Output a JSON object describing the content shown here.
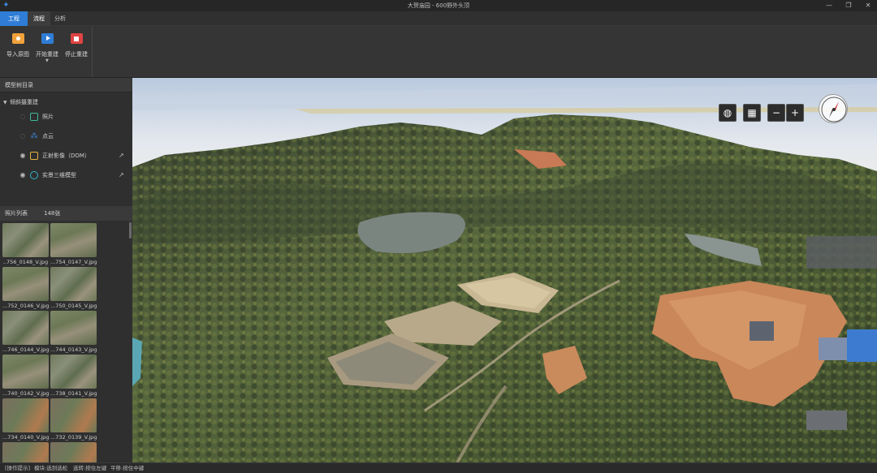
{
  "window": {
    "title": "大贺庙园 - 600野外头顶"
  },
  "menu": {
    "tabs": [
      "工程",
      "流程",
      "分析"
    ]
  },
  "ribbon": {
    "buttons": [
      {
        "label": "导入原图",
        "icon": "folder-camera-icon"
      },
      {
        "label": "开始重建",
        "icon": "play-icon"
      },
      {
        "label": "停止重建",
        "icon": "stop-icon"
      }
    ]
  },
  "tree": {
    "header": "模型树目录",
    "root": "倾斜摄重建",
    "items": [
      {
        "label": "照片",
        "icon": "photo-icon",
        "visible": false
      },
      {
        "label": "点云",
        "icon": "point-cloud-icon",
        "visible": false
      },
      {
        "label": "正射影像（DOM）",
        "icon": "dom-icon",
        "visible": true
      },
      {
        "label": "实景三维模型",
        "icon": "mesh-icon",
        "visible": true
      }
    ]
  },
  "photos": {
    "title": "照片列表",
    "count": "148张",
    "items": [
      "..756_0148_V.jpg",
      "...754_0147_V.jpg",
      "...752_0146_V.jpg",
      "...750_0145_V.jpg",
      "...746_0144_V.jpg",
      "...744_0143_V.jpg",
      "...740_0142_V.jpg",
      "...738_0141_V.jpg",
      "...734_0140_V.jpg",
      "...732_0139_V.jpg",
      "",
      ""
    ]
  },
  "viewport": {
    "tools": [
      "globe-icon",
      "layers-icon",
      "zoom-out-icon",
      "zoom-in-icon"
    ],
    "zoom_out": "−",
    "zoom_in": "+"
  },
  "status": {
    "items": [
      "[操作提示]",
      "模块:选到选松",
      "选转:按住左键",
      "平移:按住中键"
    ]
  }
}
